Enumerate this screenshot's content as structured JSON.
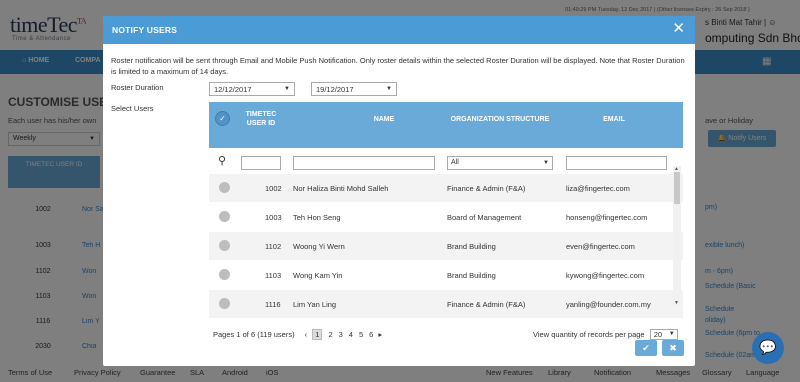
{
  "app": {
    "logo_main": "timeTec",
    "logo_tag": "TA",
    "logo_sub": "Time & Attendance",
    "top_info": "01:49:29 PM Tuesday, 12 Dec 2017 | (Other licenses Expiry : 26 Sep 2018 )",
    "user_name": "s Binti Mat Tahir | ☺",
    "company": "omputing Sdn Bhd",
    "nav_home": "HOME",
    "nav_2": "COMPA",
    "page_title": "CUSTOMISE USER L",
    "page_sub": "Each user has his/her own",
    "view_select": "Weekly",
    "table_header": "TIMETEC USER ID",
    "right_text": "ave or Holiday",
    "notify_button": "Notify Users",
    "bg_rows": [
      {
        "id": "1002",
        "link": "Nor Sall"
      },
      {
        "id": "1003",
        "link": "Teh H"
      },
      {
        "id": "1102",
        "link": "Won"
      },
      {
        "id": "1103",
        "link": "Won"
      },
      {
        "id": "1116",
        "link": "Lim Y"
      },
      {
        "id": "2030",
        "link": "Chia"
      }
    ],
    "bg_right_links": [
      "pm)",
      "exible lunch)",
      "m - 6pm)",
      "Schedule (Basic",
      "Schedule",
      "oliday)",
      "Schedule (6pm to",
      "Schedule (02am"
    ],
    "footer": [
      "Terms of Use",
      "Privacy Policy",
      "Guarantee",
      "SLA",
      "Android",
      "iOS",
      "New Features",
      "Library",
      "Notification",
      "Messages",
      "Glossary",
      "Language"
    ]
  },
  "modal": {
    "title": "NOTIFY USERS",
    "notice": "Roster notification will be sent through Email and Mobile Push Notification. Only roster details within the selected Roster Duration will be displayed. Note that Roster Duration is limited to a maximum of 14 days.",
    "roster_label": "Roster Duration",
    "date_from": "12/12/2017",
    "date_to": "19/12/2017",
    "select_users_label": "Select Users",
    "columns": {
      "user_id": "TIMETEC USER ID",
      "name": "NAME",
      "org": "ORGANIZATION STRUCTURE",
      "email": "EMAIL"
    },
    "filter_org": "All",
    "rows": [
      {
        "id": "1002",
        "name": "Nor Haliza Binti Mohd Salleh",
        "org": "Finance & Admin (F&A)",
        "email": "liza@fingertec.com"
      },
      {
        "id": "1003",
        "name": "Teh Hon Seng",
        "org": "Board of Management",
        "email": "honseng@fingertec.com"
      },
      {
        "id": "1102",
        "name": "Woong Yi Wern",
        "org": "Brand Building",
        "email": "even@fingertec.com"
      },
      {
        "id": "1103",
        "name": "Wong Kam Yin",
        "org": "Brand Building",
        "email": "kywong@fingertec.com"
      },
      {
        "id": "1116",
        "name": "Lim Yan Ling",
        "org": "Finance & Admin (F&A)",
        "email": "yanling@founder.com.my"
      }
    ],
    "pagination": {
      "summary": "Pages 1 of 6 (119 users)",
      "prev": "‹",
      "pages": [
        "1",
        "2",
        "3",
        "4",
        "5",
        "6"
      ],
      "next": "▸",
      "per_page_label": "View quantity of records per page",
      "per_page_value": "20"
    },
    "ok_icon": "✔",
    "cancel_icon": "✖"
  },
  "colors": {
    "header_blue": "#4a9bd6",
    "table_blue": "#6aaad8",
    "nav_blue": "#3d8fcb"
  }
}
